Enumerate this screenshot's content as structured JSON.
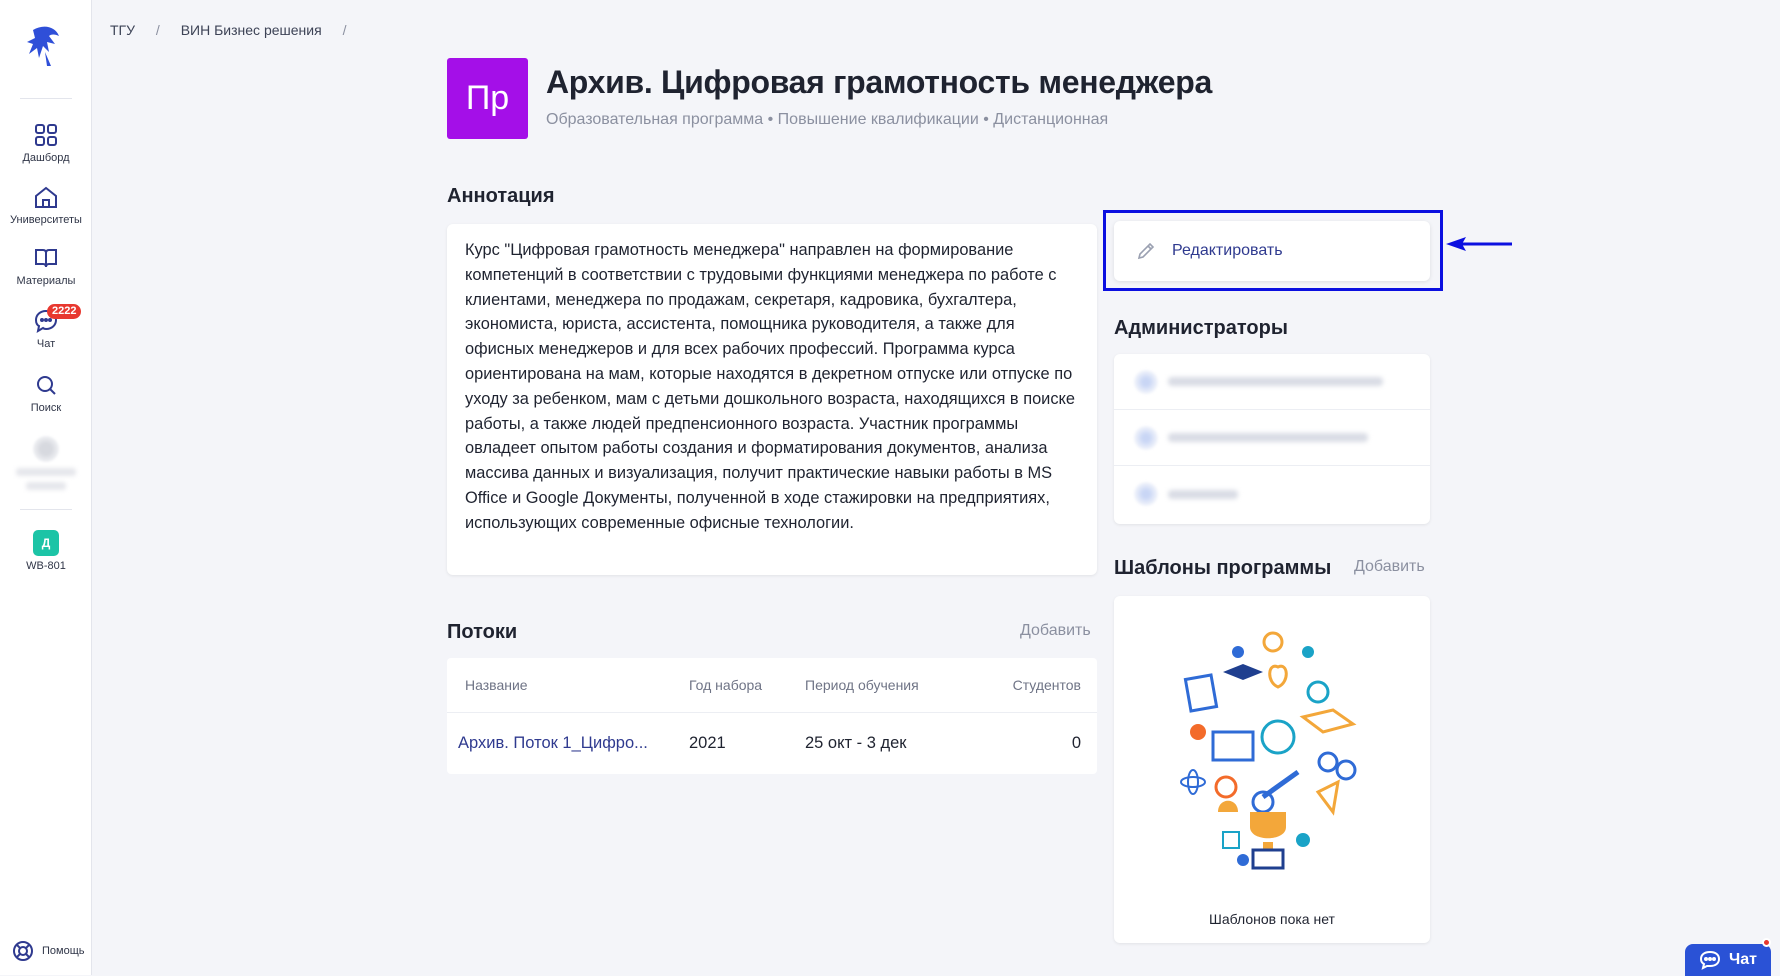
{
  "sidebar": {
    "items": [
      {
        "label": "Дашборд"
      },
      {
        "label": "Университеты"
      },
      {
        "label": "Материалы"
      },
      {
        "label": "Чат",
        "badge": "2222"
      },
      {
        "label": "Поиск"
      }
    ],
    "workspace": {
      "avatar_letter": "Д",
      "label": "WB-801"
    },
    "help_label": "Помощь"
  },
  "breadcrumb": [
    "ТГУ",
    "ВИН Бизнес решения"
  ],
  "program": {
    "icon_text": "Пр",
    "title": "Архив. Цифровая грамотность менеджера",
    "subtitle": "Образовательная программа • Повышение квалификации • Дистанционная"
  },
  "annotation": {
    "heading": "Аннотация",
    "text": "Курс \"Цифровая грамотность менеджера\" направлен на формирование компетенций в соответствии с трудовыми функциями менеджера по работе с клиентами, менеджера по продажам, секретаря, кадровика, бухгалтера, экономиста, юриста, ассистента, помощника руководителя, а также для офисных менеджеров и для всех рабочих профессий. Программа курса ориентирована на мам, которые находятся в декретном отпуске или отпуске по уходу за ребенком, мам с детьми дошкольного возраста, находящихся в поиске работы, а также людей предпенсионного возраста. Участник программы овладеет опытом работы создания и форматирования документов, анализа массива данных и визуализация, получит практические навыки работы в MS Office и Google Документы, полученной в ходе стажировки на предприятиях, использующих современные офисные технологии."
  },
  "edit_button": {
    "label": "Редактировать"
  },
  "admins": {
    "heading": "Администраторы"
  },
  "streams": {
    "heading": "Потоки",
    "add_label": "Добавить",
    "columns": [
      "Название",
      "Год набора",
      "Период обучения",
      "Студентов"
    ],
    "rows": [
      {
        "name": "Архив. Поток 1_Цифро...",
        "year": "2021",
        "period": "25 окт - 3 дек",
        "students": "0"
      }
    ]
  },
  "templates": {
    "heading": "Шаблоны программы",
    "add_label": "Добавить",
    "empty_text": "Шаблонов пока нет"
  },
  "chat_button": {
    "label": "Чат"
  },
  "colors": {
    "accent": "#2f3a8f",
    "program_icon": "#a40fe8",
    "highlight": "#0b0fe0",
    "badge": "#e8382f",
    "chat": "#2a52d6"
  }
}
